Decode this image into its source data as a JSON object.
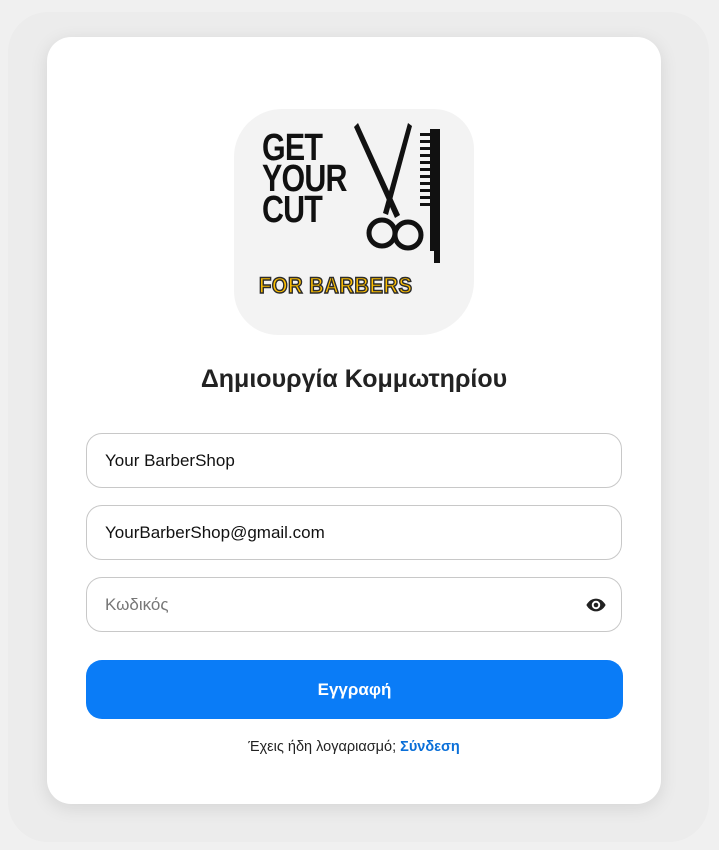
{
  "logo": {
    "line1": "GET",
    "line2": "YOUR",
    "line3": "CUT",
    "subtitle": "FOR BARBERS",
    "icons": [
      "scissors-icon",
      "comb-icon"
    ],
    "subtitle_color": "#ffc000"
  },
  "form": {
    "title": "Δημιουργία Κομμωτηρίου",
    "shop_name_value": "Your BarberShop",
    "email_value": "YourBarberShop@gmail.com",
    "password_placeholder": "Κωδικός",
    "submit_label": "Εγγραφή"
  },
  "footer": {
    "prompt": "Έχεις ήδη λογαριασμό;",
    "login_link": "Σύνδεση"
  },
  "colors": {
    "accent": "#0a7cf7",
    "link": "#0a6fd8"
  }
}
